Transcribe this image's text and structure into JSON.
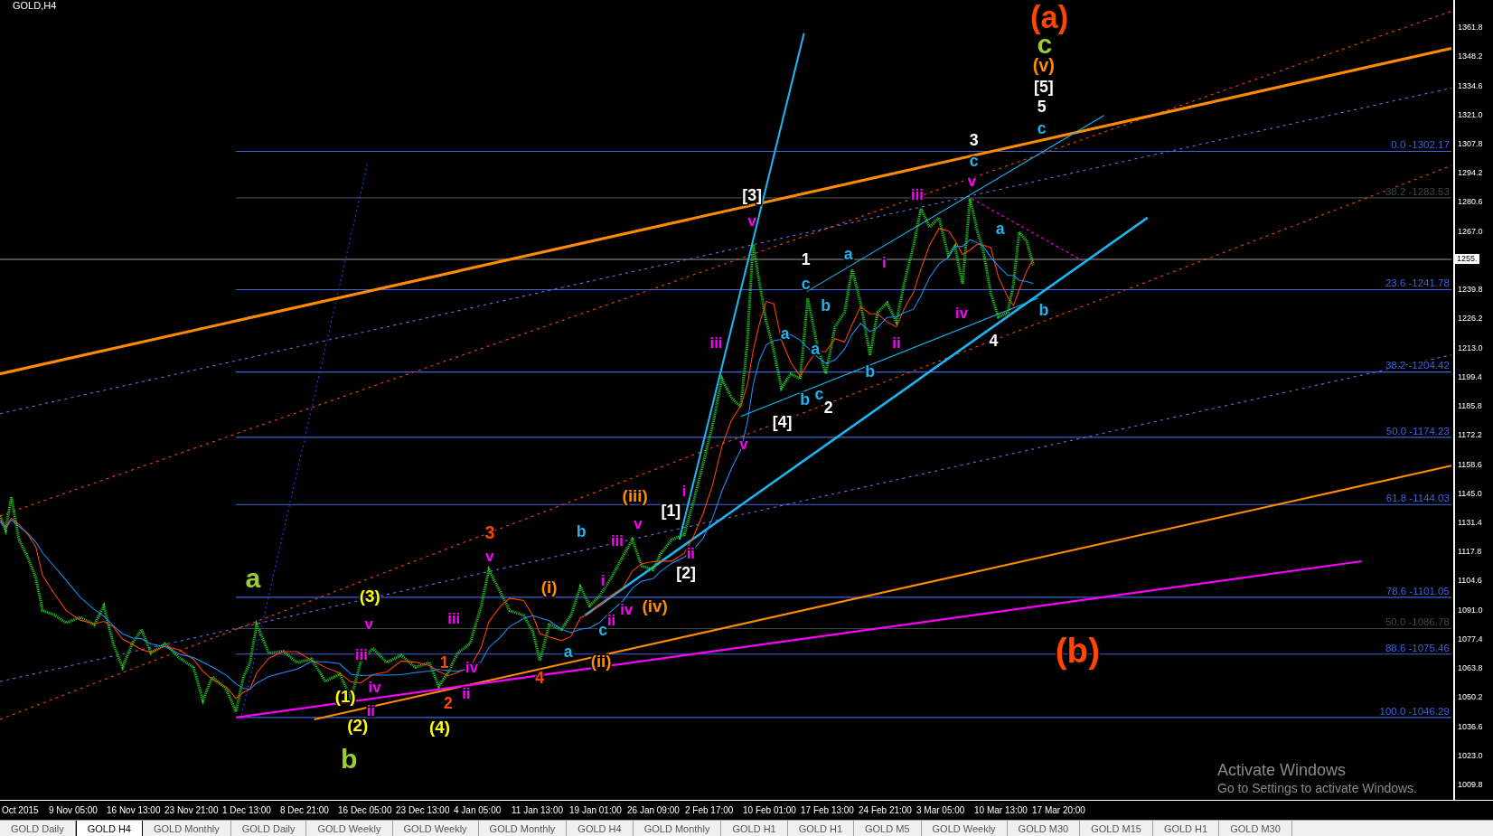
{
  "chart": {
    "symbol": "GOLD,H4",
    "wave_labels": [
      {
        "text": "(a)",
        "color": "#ff4500"
      },
      {
        "text": "(b)",
        "color": "#ff4500"
      },
      {
        "text": "c",
        "color": "#9acd32"
      },
      {
        "text": "a",
        "color": "#9acd32"
      },
      {
        "text": "b",
        "color": "#9acd32"
      },
      {
        "text": "(v)",
        "color": "#ff8c00"
      },
      {
        "text": "[5]",
        "color": "#ffffff"
      },
      {
        "text": "5",
        "color": "#ffffff"
      },
      {
        "text": "c",
        "color": "#1eb4f0"
      },
      {
        "text": "3",
        "color": "#ffffff"
      },
      {
        "text": "c",
        "color": "#1eb4f0"
      },
      {
        "text": "v",
        "color": "#ff00ff"
      },
      {
        "text": "iii",
        "color": "#ff00ff"
      },
      {
        "text": "[3]",
        "color": "#ffffff"
      },
      {
        "text": "v",
        "color": "#ff00ff"
      },
      {
        "text": "1",
        "color": "#ffffff"
      },
      {
        "text": "a",
        "color": "#1eb4f0"
      },
      {
        "text": "i",
        "color": "#ff00ff"
      },
      {
        "text": "a",
        "color": "#1eb4f0"
      },
      {
        "text": "c",
        "color": "#1eb4f0"
      },
      {
        "text": "b",
        "color": "#1eb4f0"
      },
      {
        "text": "iv",
        "color": "#ff00ff"
      },
      {
        "text": "b",
        "color": "#1eb4f0"
      },
      {
        "text": "a",
        "color": "#1eb4f0"
      },
      {
        "text": "iii",
        "color": "#ff00ff"
      },
      {
        "text": "ii",
        "color": "#ff00ff"
      },
      {
        "text": "4",
        "color": "#ffffff"
      },
      {
        "text": "a",
        "color": "#1eb4f0"
      },
      {
        "text": "b",
        "color": "#1eb4f0"
      },
      {
        "text": "c",
        "color": "#1eb4f0"
      },
      {
        "text": "b",
        "color": "#1eb4f0"
      },
      {
        "text": "2",
        "color": "#ffffff"
      },
      {
        "text": "[4]",
        "color": "#ffffff"
      },
      {
        "text": "v",
        "color": "#ff00ff"
      },
      {
        "text": "(iii)",
        "color": "#ff8c00"
      },
      {
        "text": "v",
        "color": "#ff00ff"
      },
      {
        "text": "[1]",
        "color": "#ffffff"
      },
      {
        "text": "i",
        "color": "#ff00ff"
      },
      {
        "text": "3",
        "color": "#ff4500"
      },
      {
        "text": "v",
        "color": "#ff00ff"
      },
      {
        "text": "b",
        "color": "#1eb4f0"
      },
      {
        "text": "iii",
        "color": "#ff00ff"
      },
      {
        "text": "ii",
        "color": "#ff00ff"
      },
      {
        "text": "[2]",
        "color": "#ffffff"
      },
      {
        "text": "(3)",
        "color": "#ffff00"
      },
      {
        "text": "v",
        "color": "#ff00ff"
      },
      {
        "text": "(i)",
        "color": "#ff8c00"
      },
      {
        "text": "i",
        "color": "#ff00ff"
      },
      {
        "text": "iv",
        "color": "#ff00ff"
      },
      {
        "text": "(iv)",
        "color": "#ff8c00"
      },
      {
        "text": "ii",
        "color": "#ff00ff"
      },
      {
        "text": "c",
        "color": "#1eb4f0"
      },
      {
        "text": "iii",
        "color": "#ff00ff"
      },
      {
        "text": "a",
        "color": "#1eb4f0"
      },
      {
        "text": "(ii)",
        "color": "#ff8c00"
      },
      {
        "text": "iii",
        "color": "#ff00ff"
      },
      {
        "text": "iv",
        "color": "#ff00ff"
      },
      {
        "text": "iv",
        "color": "#ff00ff"
      },
      {
        "text": "1",
        "color": "#ff4500"
      },
      {
        "text": "ii",
        "color": "#ff00ff"
      },
      {
        "text": "2",
        "color": "#ff4500"
      },
      {
        "text": "4",
        "color": "#ff4500"
      },
      {
        "text": "(1)",
        "color": "#ffff00"
      },
      {
        "text": "ii",
        "color": "#ff00ff"
      },
      {
        "text": "(2)",
        "color": "#ffff00"
      },
      {
        "text": "(4)",
        "color": "#ffff00"
      }
    ],
    "fib_levels": [
      {
        "text": "0.0 -1302.17",
        "color": "#3c64dc"
      },
      {
        "text": "38.2 -1283.53",
        "color": "#3c4a46"
      },
      {
        "text": "23.6 -1241.78",
        "color": "#3c64dc"
      },
      {
        "text": "38.2 -1204.42",
        "color": "#3c64dc"
      },
      {
        "text": "50.0 -1174.23",
        "color": "#3c64dc"
      },
      {
        "text": "61.8 -1144.03",
        "color": "#3c64dc"
      },
      {
        "text": "78.6 -1101.05",
        "color": "#3c64dc"
      },
      {
        "text": "50.0 -1086.78",
        "color": "#3c4a46"
      },
      {
        "text": "88.6 -1075.46",
        "color": "#3c64dc"
      },
      {
        "text": "100.0 -1046.29",
        "color": "#3c64dc"
      }
    ],
    "price_axis": [
      "1361.8",
      "1348.2",
      "1334.6",
      "1321.0",
      "1307.8",
      "1294.2",
      "1280.6",
      "1267.0",
      "1239.8",
      "1226.2",
      "1213.0",
      "1199.4",
      "1185.8",
      "1172.2",
      "1158.6",
      "1145.0",
      "1131.4",
      "1117.8",
      "1104.6",
      "1091.0",
      "1077.4",
      "1063.8",
      "1050.2",
      "1036.6",
      "1023.0",
      "1009.8"
    ],
    "current_price": "1255.",
    "time_axis": [
      "Oct 2015",
      "9 Nov 05:00",
      "16 Nov 13:00",
      "23 Nov 21:00",
      "1 Dec 13:00",
      "8 Dec 21:00",
      "16 Dec 05:00",
      "23 Dec 13:00",
      "4 Jan 05:00",
      "11 Jan 13:00",
      "19 Jan 01:00",
      "26 Jan 09:00",
      "2 Feb 17:00",
      "10 Feb 01:00",
      "17 Feb 13:00",
      "24 Feb 21:00",
      "3 Mar 05:00",
      "10 Mar 13:00",
      "17 Mar 20:00"
    ]
  },
  "tabs": [
    {
      "label": "GOLD Daily",
      "selected": false
    },
    {
      "label": "GOLD H4",
      "selected": true
    },
    {
      "label": "GOLD Monthly",
      "selected": false
    },
    {
      "label": "GOLD Daily",
      "selected": false
    },
    {
      "label": "GOLD Weekly",
      "selected": false
    },
    {
      "label": "GOLD Weekly",
      "selected": false
    },
    {
      "label": "GOLD Monthly",
      "selected": false
    },
    {
      "label": "GOLD H4",
      "selected": false
    },
    {
      "label": "GOLD Monthly",
      "selected": false
    },
    {
      "label": "GOLD H1",
      "selected": false
    },
    {
      "label": "GOLD H1",
      "selected": false
    },
    {
      "label": "GOLD M5",
      "selected": false
    },
    {
      "label": "GOLD Weekly",
      "selected": false
    },
    {
      "label": "GOLD M30",
      "selected": false
    },
    {
      "label": "GOLD M15",
      "selected": false
    },
    {
      "label": "GOLD H1",
      "selected": false
    },
    {
      "label": "GOLD M30",
      "selected": false
    }
  ],
  "os_notice": {
    "title": "Activate Windows",
    "subtitle": "Go to Settings to activate Windows."
  }
}
